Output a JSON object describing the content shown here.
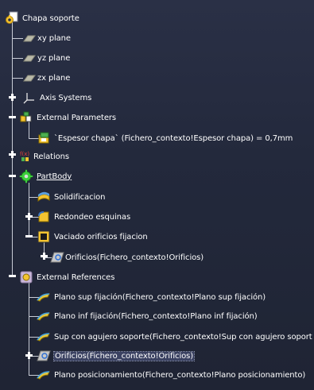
{
  "tree": {
    "root": {
      "label": "Chapa soporte",
      "icon": "part-document-icon"
    },
    "planes": [
      {
        "label": "xy plane",
        "icon": "plane-icon"
      },
      {
        "label": "yz plane",
        "icon": "plane-icon"
      },
      {
        "label": "zx plane",
        "icon": "plane-icon"
      }
    ],
    "axis_systems": {
      "label": "Axis Systems",
      "icon": "axis-system-icon"
    },
    "external_parameters": {
      "label": "External Parameters",
      "icon": "parameters-icon",
      "children": [
        {
          "label": "`Espesor chapa` (Fichero_contexto!Espesor chapa) = 0,7mm",
          "icon": "parameter-value-icon"
        }
      ]
    },
    "relations": {
      "label": "Relations",
      "icon": "relations-icon"
    },
    "partbody": {
      "label": "PartBody",
      "icon": "gear-body-icon",
      "children": [
        {
          "label": "Solidificacion",
          "icon": "solidify-icon"
        },
        {
          "label": "Redondeo esquinas",
          "icon": "fillet-icon"
        },
        {
          "label": "Vaciado orificios fijacion",
          "icon": "pocket-icon",
          "children": [
            {
              "label": "Orificios(Fichero_contexto!Orificios)",
              "icon": "sketch-icon"
            }
          ]
        }
      ]
    },
    "external_references": {
      "label": "External References",
      "icon": "external-references-icon",
      "children": [
        {
          "label": "Plano sup fijación(Fichero_contexto!Plano sup fijación)",
          "icon": "surface-icon"
        },
        {
          "label": "Plano inf fijación(Fichero_contexto!Plano inf fijación)",
          "icon": "surface-icon"
        },
        {
          "label": "Sup con agujero soporte(Fichero_contexto!Sup con agujero soport",
          "icon": "surface-icon"
        },
        {
          "label": "Orificios(Fichero_contexto!Orificios)",
          "icon": "sketch-icon"
        },
        {
          "label": "Plano posicionamiento(Fichero_contexto!Plano posicionamiento)",
          "icon": "surface-icon"
        }
      ]
    }
  }
}
